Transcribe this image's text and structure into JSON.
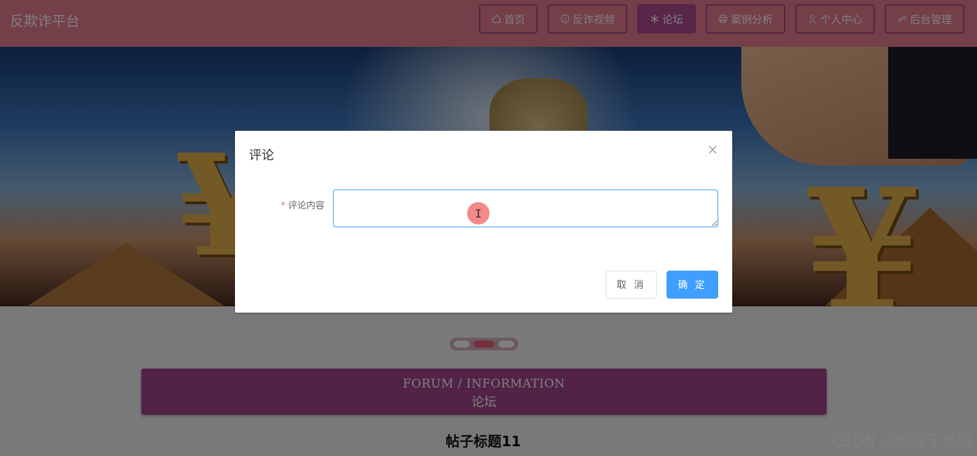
{
  "header": {
    "brand": "反欺诈平台",
    "nav": [
      {
        "label": "首页",
        "icon": "home-icon"
      },
      {
        "label": "反诈视频",
        "icon": "smile-icon"
      },
      {
        "label": "论坛",
        "icon": "snowflake-icon",
        "active": true
      },
      {
        "label": "案例分析",
        "icon": "printer-icon"
      },
      {
        "label": "个人中心",
        "icon": "user-icon"
      },
      {
        "label": "后台管理",
        "icon": "link-icon"
      }
    ]
  },
  "forum": {
    "title_en": "FORUM / INFORMATION",
    "title_cn": "论坛",
    "post_title": "帖子标题11"
  },
  "watermark": "CSDN @编程千纸鹤",
  "dialog": {
    "title": "评论",
    "field_label": "评论内容",
    "field_required_mark": "*",
    "field_value": "",
    "cursor_glyph": "I",
    "cancel_label": "取 消",
    "confirm_label": "确 定"
  },
  "colors": {
    "header_bg": "#e87f92",
    "nav_border": "#a64a86",
    "nav_active": "#b14c93",
    "forum_box": "#a5468e",
    "primary_button": "#409eff"
  }
}
